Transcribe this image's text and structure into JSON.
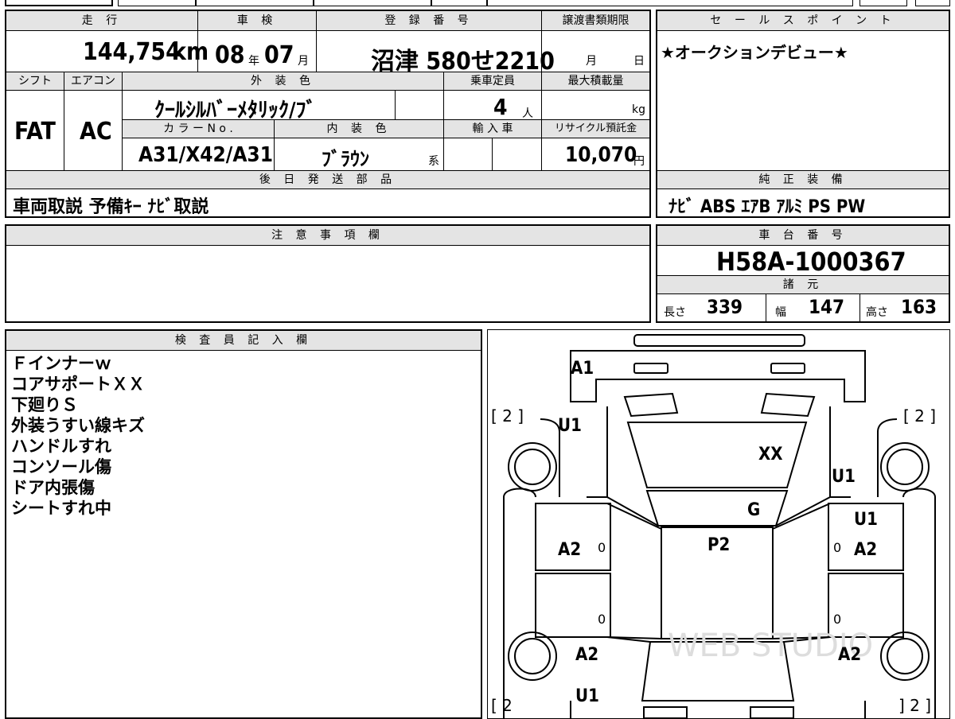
{
  "vehicle": {
    "mileage_label": "走 行",
    "mileage_value": "144,754",
    "mileage_unit": "km",
    "inspection_label": "車 検",
    "inspection_year": "08",
    "inspection_year_unit": "年",
    "inspection_month": "07",
    "inspection_month_unit": "月",
    "registration_label": "登 録 番 号",
    "registration_number": "沼津 580せ2210",
    "transfer_deadline_label": "譲渡書類期限",
    "transfer_month_unit": "月",
    "transfer_day_unit": "日",
    "shift_label": "シフト",
    "shift_value": "FAT",
    "aircon_label": "エアコン",
    "aircon_value": "AC",
    "exterior_color_label": "外 装 色",
    "exterior_color_value": "ｸｰﾙｼﾙﾊﾞｰﾒﾀﾘｯｸ/ﾌﾞ",
    "capacity_label": "乗車定員",
    "capacity_value": "4",
    "capacity_unit": "人",
    "max_load_label": "最大積載量",
    "max_load_unit": "kg",
    "color_no_label": "カ ラ ー N o .",
    "color_no_value": "A31/X42/A31",
    "interior_color_label": "内 装 色",
    "interior_color_value": "ﾌﾞﾗｳﾝ",
    "interior_color_suffix": "系",
    "import_label": "輸 入 車",
    "recycle_label": "リサイクル預託金",
    "recycle_value": "10,070",
    "recycle_unit": "円"
  },
  "later_parts": {
    "label": "後 日 発 送 部 品",
    "value": "車両取説 予備ｷｰ ﾅﾋﾞ取説"
  },
  "sales_point": {
    "label": "セ ー ル ス ポ イ ン ト",
    "value": "★オークションデビュー★"
  },
  "genuine_equipment": {
    "label": "純 正 装 備",
    "value": "ﾅﾋﾞ ABS ｴｱB ｱﾙﾐ PS PW"
  },
  "caution": {
    "label": "注 意 事 項 欄"
  },
  "chassis": {
    "label": "車 台 番 号",
    "value": "H58A-1000367"
  },
  "specs": {
    "label": "諸 元",
    "length_label": "長さ",
    "length_value": "339",
    "width_label": "幅",
    "width_value": "147",
    "height_label": "高さ",
    "height_value": "163"
  },
  "inspector": {
    "label": "検 査 員 記 入 欄",
    "notes": [
      "Ｆインナーｗ",
      "コアサポートＸＸ",
      "下廻りＳ",
      "外装うすい線キズ",
      "ハンドルすれ",
      "コンソール傷",
      "ドア内張傷",
      "シートすれ中"
    ]
  },
  "diagram": {
    "marks": [
      "A1",
      "U1",
      "XX",
      "U1",
      "G",
      "U1",
      "A2",
      "P2",
      "A2",
      "A2",
      "A2",
      "U1"
    ],
    "tire_left_top": "[ 2 ]",
    "tire_right_top": "[ 2 ]",
    "tire_left_bottom": "[ 2",
    "tire_right_bottom": "] 2 ]",
    "zero_marks": [
      "0",
      "0",
      "0",
      "0"
    ]
  }
}
